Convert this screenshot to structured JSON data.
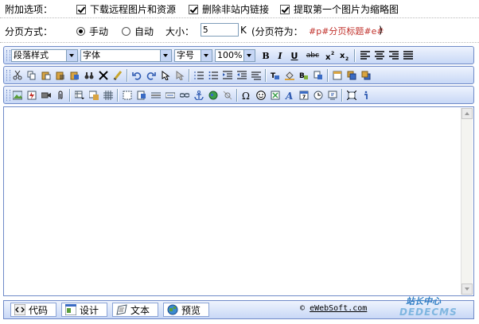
{
  "options": {
    "label": "附加选项：",
    "checkboxes": [
      {
        "label": "下载远程图片和资源",
        "checked": true
      },
      {
        "label": "删除非站内链接",
        "checked": true
      },
      {
        "label": "提取第一个图片为缩略图",
        "checked": true
      }
    ]
  },
  "paging": {
    "label": "分页方式：",
    "manual": "手动",
    "auto": "自动",
    "size_label": "大小：",
    "size_value": "5",
    "size_unit": "K",
    "separator_label": "(分页符为：",
    "separator_value": "#p#分页标题#e#",
    "close_paren": ")"
  },
  "toolbar": {
    "format": "段落样式",
    "font": "字体",
    "size": "字号",
    "zoom": "100%",
    "bold": "B",
    "italic": "I",
    "underline": "U",
    "strike": "abc"
  },
  "modes": {
    "code": "代码",
    "design": "设计",
    "text": "文本",
    "preview": "预览"
  },
  "credit": {
    "symbol": "©",
    "link": "eWebSoft.com"
  },
  "watermark": {
    "cn": "站长中心",
    "en": "DEDECMS"
  },
  "colors": {
    "toolbar_border": "#6f8ac8",
    "accent_red": "#c0302a"
  }
}
